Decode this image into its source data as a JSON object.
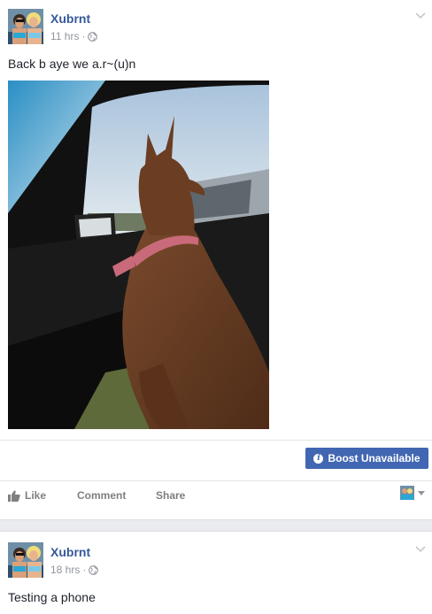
{
  "post1": {
    "author": "Xubrnt",
    "time": "11 hrs",
    "separator": "·",
    "text": "Back b aye we a.r~(u)n",
    "boost_label": "Boost Unavailable",
    "actions": {
      "like": "Like",
      "comment": "Comment",
      "share": "Share"
    }
  },
  "post2": {
    "author": "Xubrnt",
    "time": "18 hrs",
    "separator": "·",
    "text": "Testing a phone"
  },
  "colors": {
    "link_blue": "#365899",
    "boost_blue": "#4267b2",
    "meta_gray": "#90949c",
    "action_gray": "#7f7f7f"
  },
  "icons": [
    "globe-icon",
    "chevron-down-icon",
    "info-icon",
    "like-thumb-icon",
    "caret-down-icon"
  ]
}
